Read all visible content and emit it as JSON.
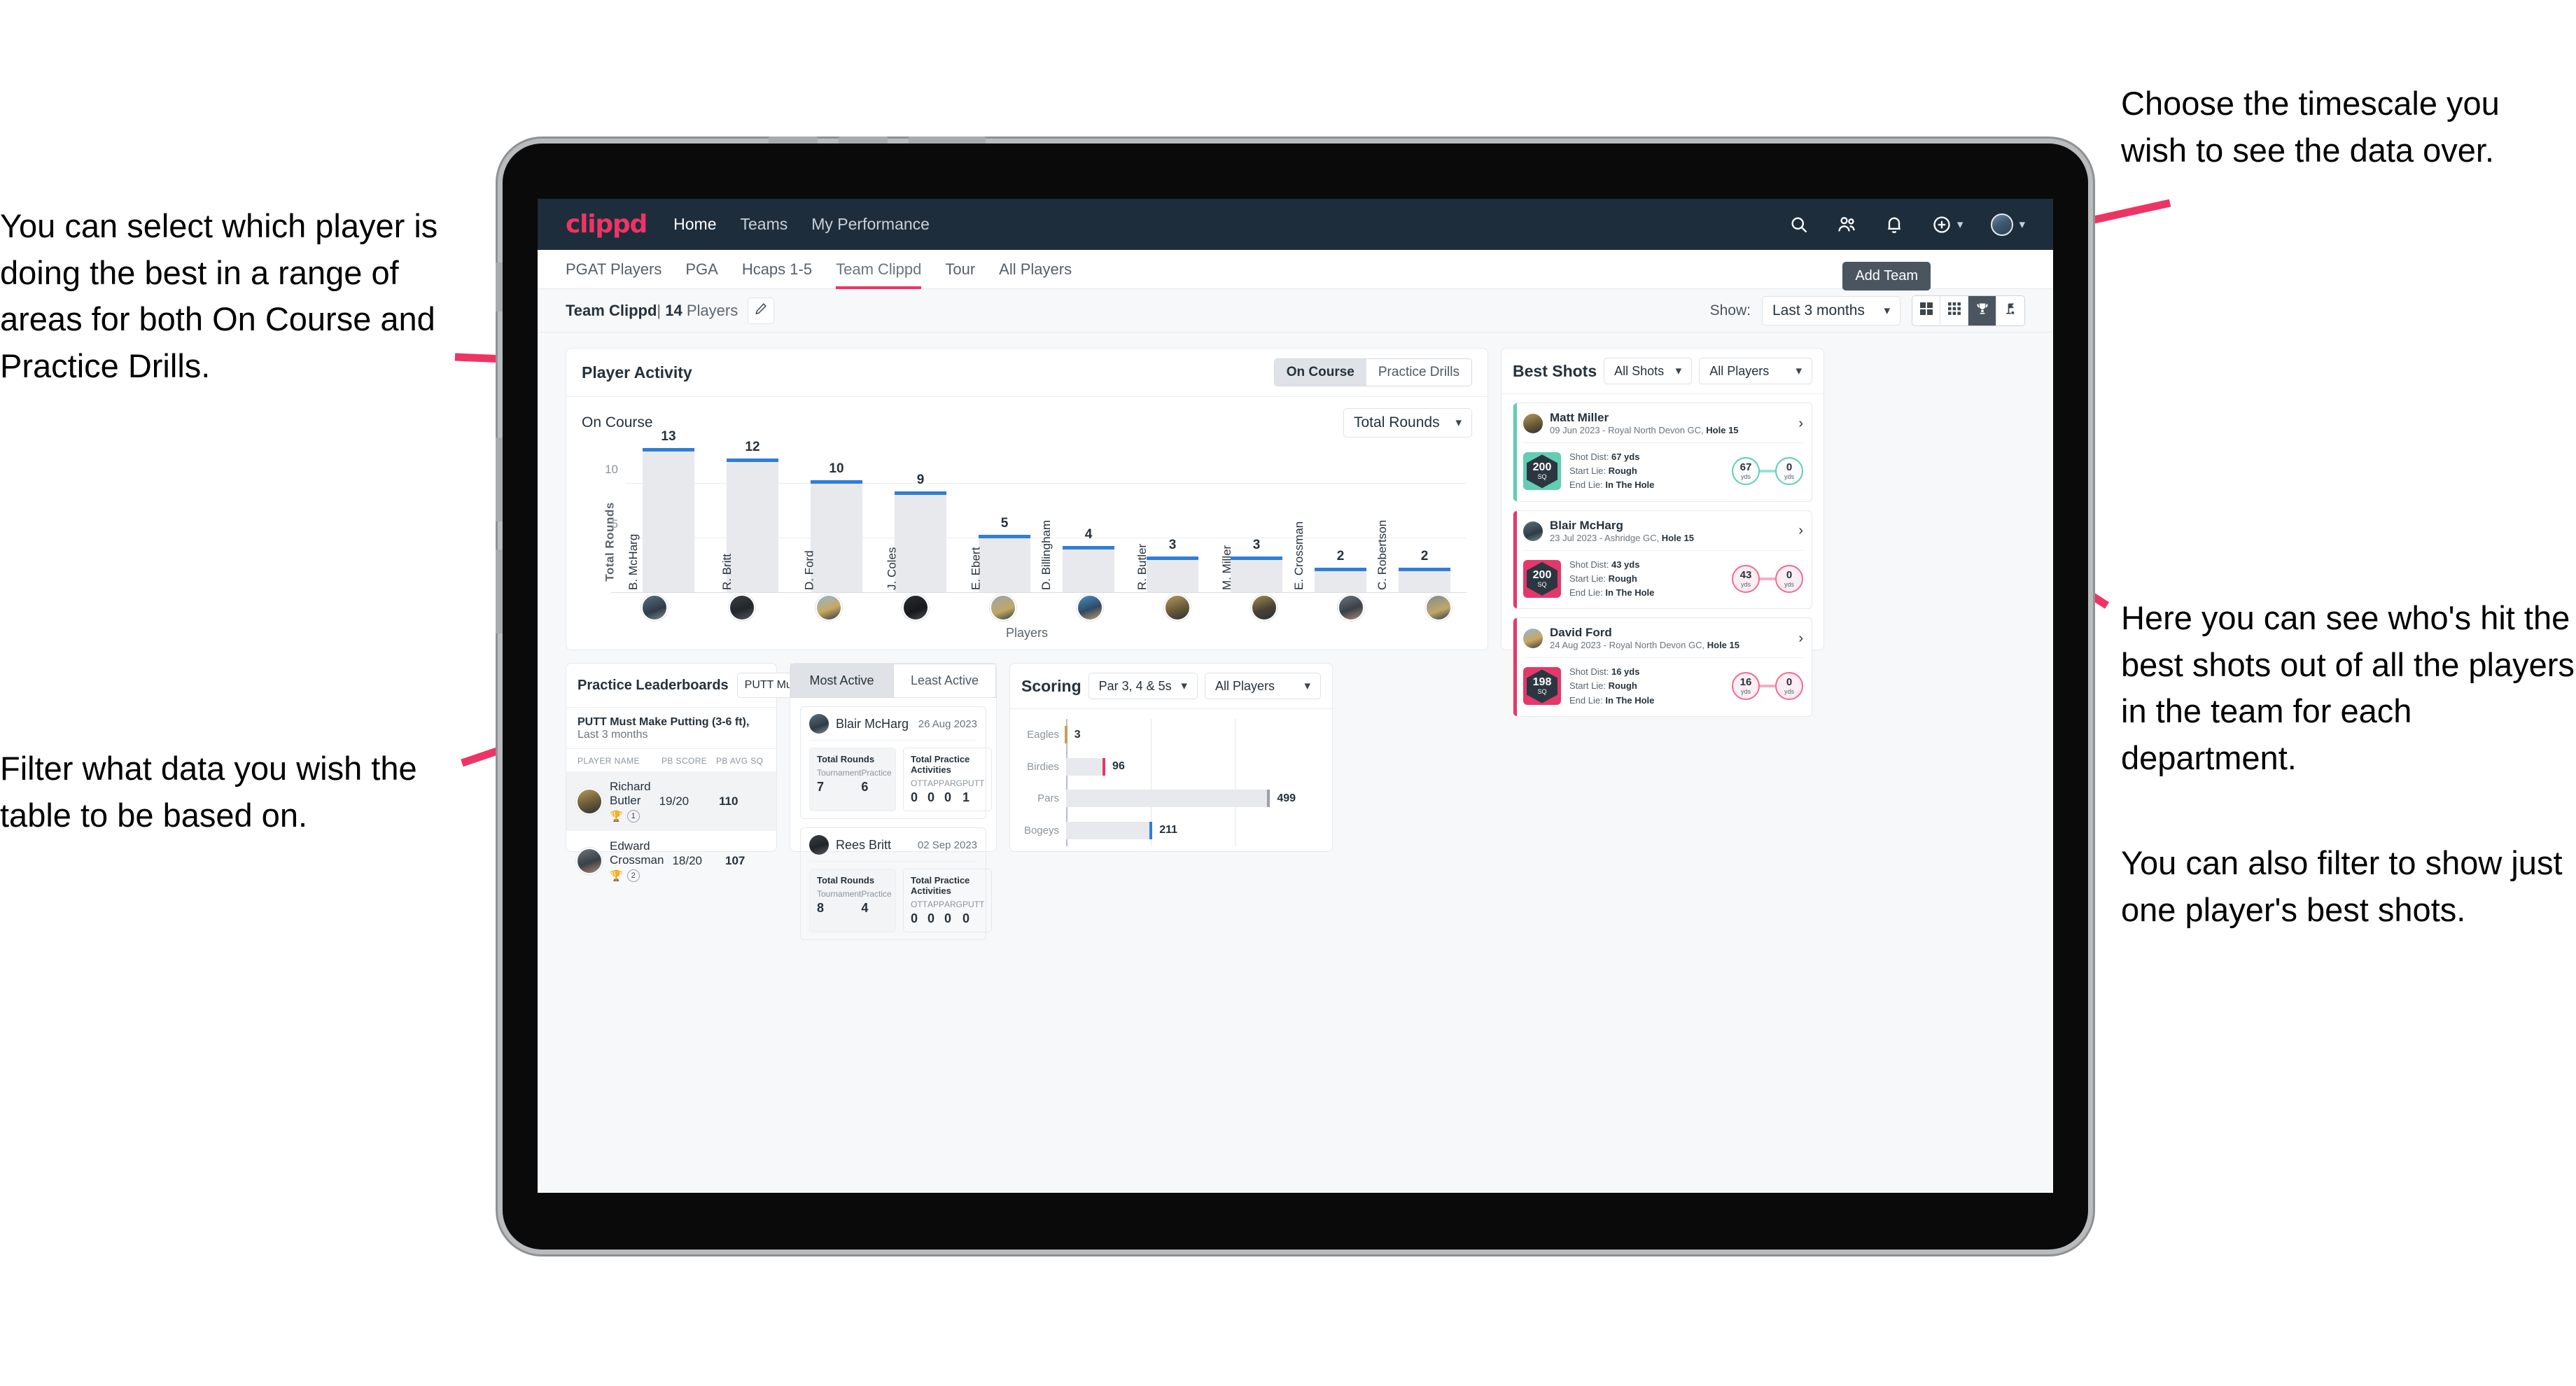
{
  "annotations": {
    "select_player": "You can select which player is doing the best in a range of areas for both On Course and Practice Drills.",
    "filter_table": "Filter what data you wish the table to be based on.",
    "timescale": "Choose the timescale you wish to see the data over.",
    "best_shots": "Here you can see who's hit the best shots out of all the players in the team for each department.",
    "filter_player": "You can also filter to show just one player's best shots."
  },
  "topnav": {
    "brand": "clippd",
    "links": [
      {
        "label": "Home",
        "active": true
      },
      {
        "label": "Teams",
        "active": false
      },
      {
        "label": "My Performance",
        "active": false
      }
    ],
    "icons": [
      "search-icon",
      "people-icon",
      "bell-icon",
      "plus-circle-icon",
      "user-avatar"
    ]
  },
  "tabs": [
    {
      "label": "PGAT Players",
      "active": false
    },
    {
      "label": "PGA",
      "active": false
    },
    {
      "label": "Hcaps 1-5",
      "active": false
    },
    {
      "label": "Team Clippd",
      "active": true
    },
    {
      "label": "Tour",
      "active": false
    },
    {
      "label": "All Players",
      "active": false
    }
  ],
  "tooltip": {
    "add_team": "Add Team"
  },
  "subbar": {
    "team_name": "Team Clippd",
    "separator": "|",
    "player_count": "14",
    "players_word": "Players",
    "edit_icon": "pencil-icon",
    "show_label": "Show:",
    "timescale_value": "Last 3 months",
    "view_buttons": [
      "grid-2x2-icon",
      "grid-3x3-icon",
      "trophy-icon",
      "flag-icon"
    ],
    "view_selected_index": 2
  },
  "player_activity": {
    "title": "Player Activity",
    "segments": [
      {
        "label": "On Course",
        "on": true
      },
      {
        "label": "Practice Drills",
        "on": false
      }
    ],
    "sub_label": "On Course",
    "metric_select": "Total Rounds"
  },
  "chart_data": {
    "type": "bar",
    "title": "Player Activity - On Course",
    "xlabel": "Players",
    "ylabel": "Total Rounds",
    "ylim": [
      0,
      14
    ],
    "yticks": [
      5,
      10
    ],
    "grid": true,
    "categories": [
      "B. McHarg",
      "R. Britt",
      "D. Ford",
      "J. Coles",
      "E. Ebert",
      "D. Billingham",
      "R. Butler",
      "M. Miller",
      "E. Crossman",
      "C. Robertson"
    ],
    "values": [
      13,
      12,
      10,
      9,
      5,
      4,
      3,
      3,
      2,
      2
    ],
    "avatar_classes": [
      "avA",
      "avB",
      "avC",
      "avD",
      "avE",
      "avF",
      "avG",
      "avH",
      "avI",
      "avJ"
    ]
  },
  "best_shots": {
    "title": "Best Shots",
    "shot_filter": "All Shots",
    "player_filter": "All Players",
    "chevron_icon": "chevron-right-icon",
    "items": [
      {
        "name": "Matt Miller",
        "meta_date": "09 Jun 2023 - Royal North Devon GC,",
        "meta_hole": "Hole 15",
        "sq_value": "200",
        "sq_unit": "SQ",
        "accent": "teal",
        "shot_dist_label": "Shot Dist:",
        "shot_dist_value": "67 yds",
        "start_lie_label": "Start Lie:",
        "start_lie_value": "Rough",
        "end_lie_label": "End Lie:",
        "end_lie_value": "In The Hole",
        "start_dot": "67",
        "start_dot_unit": "yds",
        "end_dot": "0",
        "end_dot_unit": "yds",
        "avatar_class": "avG"
      },
      {
        "name": "Blair McHarg",
        "meta_date": "23 Jul 2023 - Ashridge GC,",
        "meta_hole": "Hole 15",
        "sq_value": "200",
        "sq_unit": "SQ",
        "accent": "pink",
        "shot_dist_label": "Shot Dist:",
        "shot_dist_value": "43 yds",
        "start_lie_label": "Start Lie:",
        "start_lie_value": "Rough",
        "end_lie_label": "End Lie:",
        "end_lie_value": "In The Hole",
        "start_dot": "43",
        "start_dot_unit": "yds",
        "end_dot": "0",
        "end_dot_unit": "yds",
        "avatar_class": "avA"
      },
      {
        "name": "David Ford",
        "meta_date": "24 Aug 2023 - Royal North Devon GC,",
        "meta_hole": "Hole 15",
        "sq_value": "198",
        "sq_unit": "SQ",
        "accent": "pink",
        "shot_dist_label": "Shot Dist:",
        "shot_dist_value": "16 yds",
        "start_lie_label": "Start Lie:",
        "start_lie_value": "Rough",
        "end_lie_label": "End Lie:",
        "end_lie_value": "In The Hole",
        "start_dot": "16",
        "start_dot_unit": "yds",
        "end_dot": "0",
        "end_dot_unit": "yds",
        "avatar_class": "avC"
      }
    ]
  },
  "practice_leaderboards": {
    "title": "Practice Leaderboards",
    "drill_select": "PUTT Must Make Putting ...",
    "subtitle_bold": "PUTT Must Make Putting (3-6 ft),",
    "subtitle_muted": "Last 3 months",
    "columns": [
      "PLAYER NAME",
      "PB SCORE",
      "PB AVG SQ"
    ],
    "rows": [
      {
        "name": "Richard Butler",
        "pb_score": "19/20",
        "pb_avg_sq": "110",
        "rank": "1",
        "trophy": "gold",
        "avatar_class": "avG",
        "highlight": true
      },
      {
        "name": "Edward Crossman",
        "pb_score": "18/20",
        "pb_avg_sq": "107",
        "rank": "2",
        "trophy": "silver",
        "avatar_class": "avI",
        "highlight": false
      }
    ]
  },
  "activity": {
    "tabs": [
      {
        "label": "Most Active",
        "on": true
      },
      {
        "label": "Least Active",
        "on": false
      }
    ],
    "rounds_title": "Total Rounds",
    "practice_title": "Total Practice Activities",
    "rounds_cols": [
      "Tournament",
      "Practice"
    ],
    "practice_cols": [
      "OTT",
      "APP",
      "ARG",
      "PUTT"
    ],
    "cards": [
      {
        "name": "Blair McHarg",
        "date": "26 Aug 2023",
        "rounds": [
          "7",
          "6"
        ],
        "practice": [
          "0",
          "0",
          "0",
          "1"
        ],
        "avatar_class": "avA"
      },
      {
        "name": "Rees Britt",
        "date": "02 Sep 2023",
        "rounds": [
          "8",
          "4"
        ],
        "practice": [
          "0",
          "0",
          "0",
          "0"
        ],
        "avatar_class": "avB"
      }
    ]
  },
  "scoring": {
    "title": "Scoring",
    "par_filter": "Par 3, 4 & 5s",
    "player_filter": "All Players",
    "chart": {
      "type": "bar",
      "orientation": "horizontal",
      "title": "Scoring",
      "categories": [
        "Eagles",
        "Birdies",
        "Pars",
        "Bogeys"
      ],
      "values": [
        3,
        96,
        499,
        211
      ],
      "xlim": [
        0,
        620
      ],
      "colors": [
        "#c2a05a",
        "#ee3465",
        "#9aa0a6",
        "#2f7ed8"
      ],
      "grid": true
    }
  },
  "colors": {
    "brand_pink": "#ee3465",
    "nav_dark": "#1e2d3b",
    "bar_blue": "#2f7ed8",
    "teal": "#62cdb3"
  }
}
